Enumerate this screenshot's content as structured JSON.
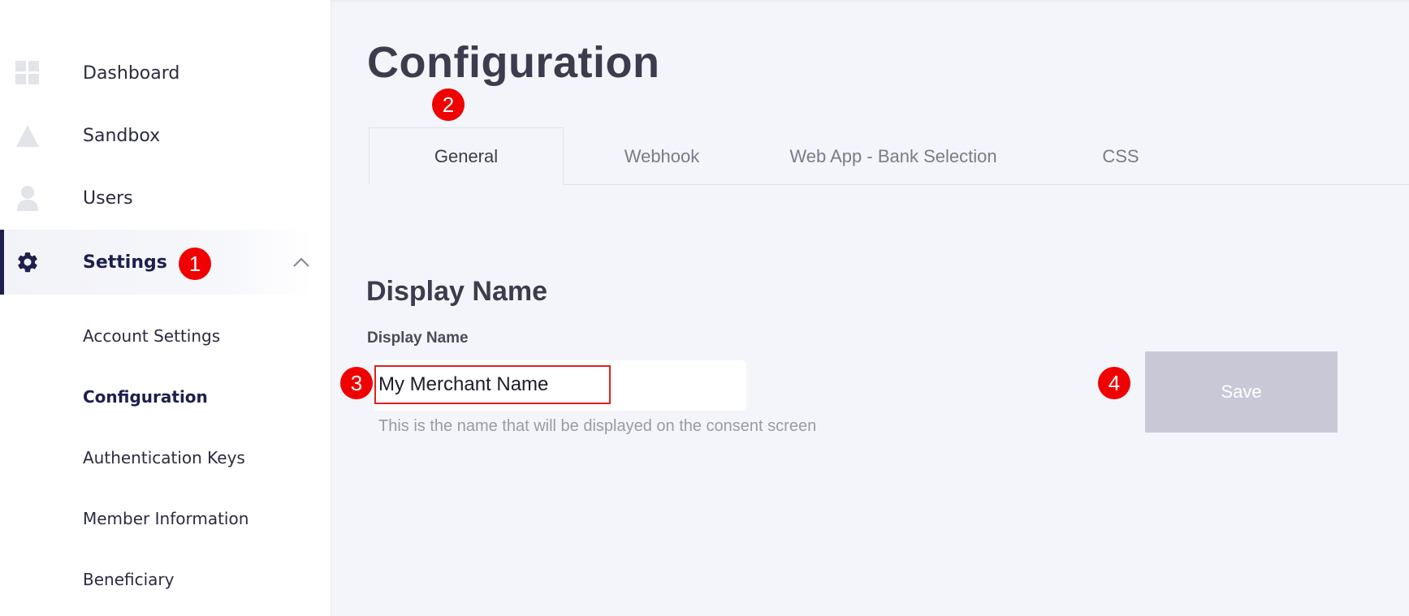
{
  "sidebar": {
    "items": [
      {
        "label": "Dashboard",
        "icon": "dashboard-icon"
      },
      {
        "label": "Sandbox",
        "icon": "sandbox-icon"
      },
      {
        "label": "Users",
        "icon": "user-icon"
      },
      {
        "label": "Settings",
        "icon": "gear-icon",
        "active": true,
        "expanded": true
      }
    ],
    "settings_subitems": [
      {
        "label": "Account Settings"
      },
      {
        "label": "Configuration",
        "current": true
      },
      {
        "label": "Authentication Keys"
      },
      {
        "label": "Member Information"
      },
      {
        "label": "Beneficiary"
      }
    ]
  },
  "main": {
    "title": "Configuration",
    "tabs": [
      {
        "label": "General",
        "active": true
      },
      {
        "label": "Webhook"
      },
      {
        "label": "Web App - Bank Selection"
      },
      {
        "label": "CSS"
      }
    ],
    "section_title": "Display Name",
    "field": {
      "label": "Display Name",
      "value": "My Merchant Name",
      "helper": "This is the name that will be displayed on the consent screen"
    },
    "save_label": "Save"
  },
  "markers": [
    "1",
    "2",
    "3",
    "4"
  ],
  "colors": {
    "accent": "#1d1f4e",
    "marker": "#f00000",
    "save_disabled": "#c9c8d6",
    "background": "#f4f5fa"
  }
}
